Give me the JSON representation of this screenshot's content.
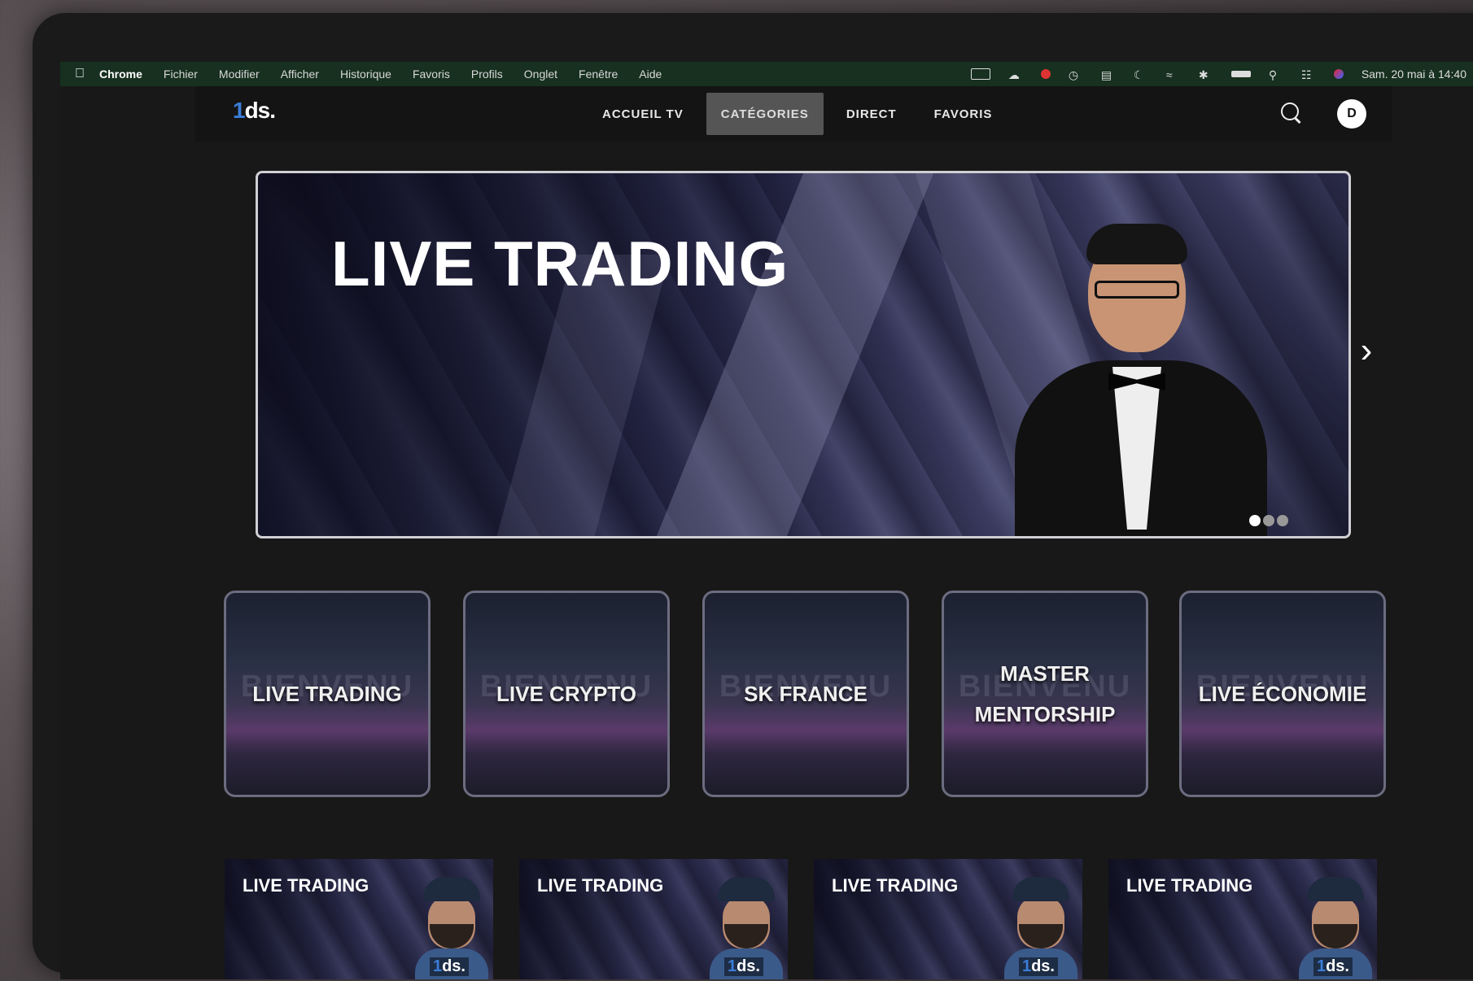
{
  "menubar": {
    "app": "Chrome",
    "items": [
      "Fichier",
      "Modifier",
      "Afficher",
      "Historique",
      "Favoris",
      "Profils",
      "Onglet",
      "Fenêtre",
      "Aide"
    ],
    "clock": "Sam. 20 mai à 14:40"
  },
  "nav": {
    "logo": "ds.",
    "logo_bar": "1",
    "links": [
      "ACCUEIL TV",
      "CATÉGORIES",
      "DIRECT",
      "FAVORIS"
    ],
    "active_link": "CATÉGORIES",
    "avatar": "D"
  },
  "hero": {
    "title": "LIVE TRADING",
    "slides": 3,
    "active_slide": 1
  },
  "categories": [
    {
      "label": "LIVE TRADING",
      "ghost": "BIENVENU"
    },
    {
      "label": "LIVE CRYPTO",
      "ghost": "BIENVENU"
    },
    {
      "label": "SK FRANCE",
      "ghost": "BIENVENU"
    },
    {
      "label": "MASTER MENTORSHIP",
      "ghost": "BIENVENU"
    },
    {
      "label": "LIVE ÉCONOMIE",
      "ghost": "BIENVENU"
    }
  ],
  "thumbnails": [
    {
      "title": "LIVE TRADING",
      "logo": "ds.",
      "logo_bar": "1"
    },
    {
      "title": "LIVE TRADING",
      "logo": "ds.",
      "logo_bar": "1"
    },
    {
      "title": "LIVE TRADING",
      "logo": "ds.",
      "logo_bar": "1"
    },
    {
      "title": "LIVE TRADING",
      "logo": "ds.",
      "logo_bar": "1"
    }
  ],
  "colors": {
    "menubar_bg": "#17301f",
    "nav_bg": "#141414",
    "active_tab": "#555555",
    "accent": "#3b7dd8"
  }
}
